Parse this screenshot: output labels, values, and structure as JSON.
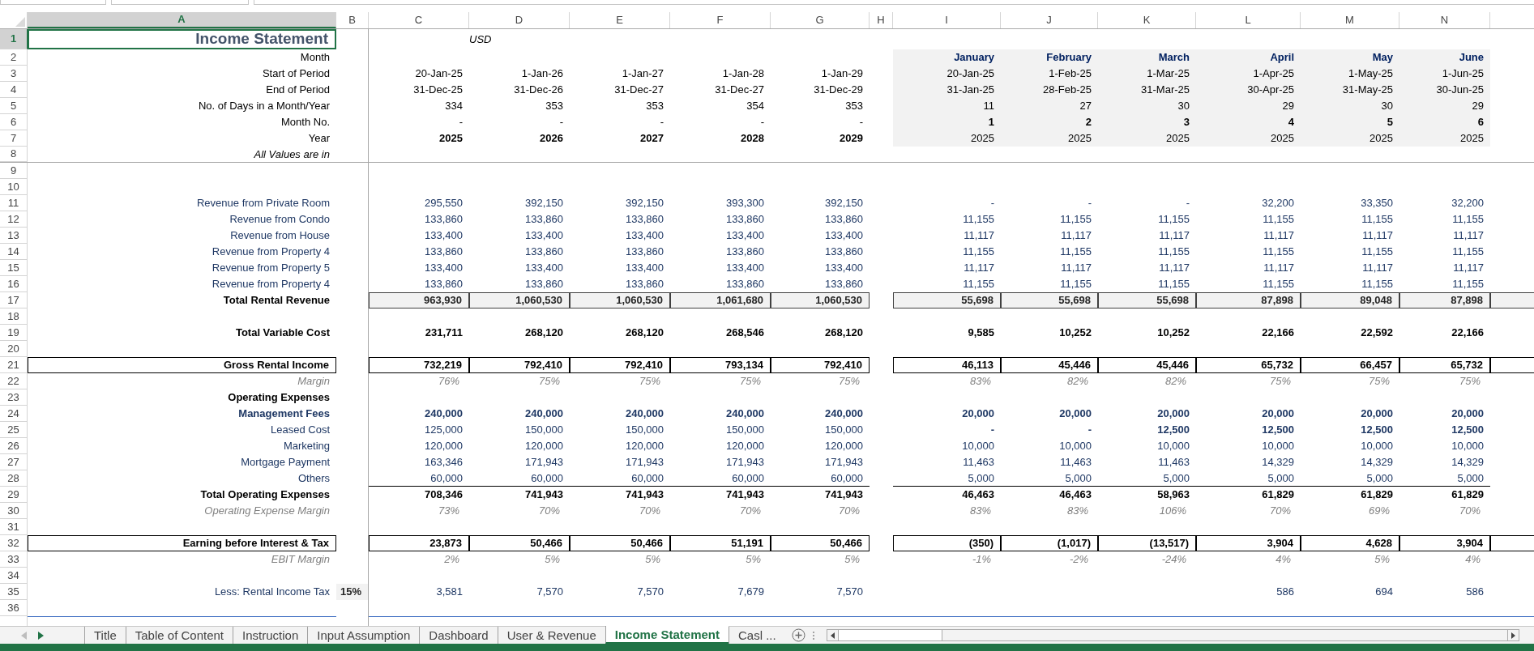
{
  "columns": [
    {
      "label": "A",
      "selected": true
    },
    {
      "label": "B",
      "selected": false
    },
    {
      "label": "C",
      "selected": false
    },
    {
      "label": "D",
      "selected": false
    },
    {
      "label": "E",
      "selected": false
    },
    {
      "label": "F",
      "selected": false
    },
    {
      "label": "G",
      "selected": false
    },
    {
      "label": "H",
      "selected": false
    },
    {
      "label": "I",
      "selected": false
    },
    {
      "label": "J",
      "selected": false
    },
    {
      "label": "K",
      "selected": false
    },
    {
      "label": "L",
      "selected": false
    },
    {
      "label": "M",
      "selected": false
    },
    {
      "label": "N",
      "selected": false
    }
  ],
  "rows": [
    {
      "number": "1",
      "selected": true,
      "kind": "title",
      "label": "Income Statement",
      "note": "USD"
    },
    {
      "number": "2",
      "selected": false,
      "kind": "header-month",
      "label": "Month",
      "monthly": [
        "January",
        "February",
        "March",
        "April",
        "May",
        "June"
      ]
    },
    {
      "number": "3",
      "selected": false,
      "kind": "plain",
      "label": "Start of Period",
      "annual": [
        "20-Jan-25",
        "1-Jan-26",
        "1-Jan-27",
        "1-Jan-28",
        "1-Jan-29"
      ],
      "monthly": [
        "20-Jan-25",
        "1-Feb-25",
        "1-Mar-25",
        "1-Apr-25",
        "1-May-25",
        "1-Jun-25"
      ]
    },
    {
      "number": "4",
      "selected": false,
      "kind": "plain",
      "label": "End of Period",
      "annual": [
        "31-Dec-25",
        "31-Dec-26",
        "31-Dec-27",
        "31-Dec-27",
        "31-Dec-29"
      ],
      "monthly": [
        "31-Jan-25",
        "28-Feb-25",
        "31-Mar-25",
        "30-Apr-25",
        "31-May-25",
        "30-Jun-25"
      ]
    },
    {
      "number": "5",
      "selected": false,
      "kind": "plain",
      "label": "No. of Days in a Month/Year",
      "annual": [
        "334",
        "353",
        "353",
        "354",
        "353"
      ],
      "monthly": [
        "11",
        "27",
        "30",
        "29",
        "30",
        "29"
      ]
    },
    {
      "number": "6",
      "selected": false,
      "kind": "monthno",
      "label": "Month No.",
      "annual": [
        "-",
        "-",
        "-",
        "-",
        "-"
      ],
      "monthly": [
        "1",
        "2",
        "3",
        "4",
        "5",
        "6"
      ]
    },
    {
      "number": "7",
      "selected": false,
      "kind": "year",
      "label": "Year",
      "annual": [
        "2025",
        "2026",
        "2027",
        "2028",
        "2029"
      ],
      "monthly": [
        "2025",
        "2025",
        "2025",
        "2025",
        "2025",
        "2025"
      ]
    },
    {
      "number": "8",
      "selected": false,
      "kind": "note",
      "label": "All Values are in"
    },
    {
      "number": "9",
      "selected": false,
      "kind": "empty"
    },
    {
      "number": "10",
      "selected": false,
      "kind": "empty"
    },
    {
      "number": "11",
      "selected": false,
      "kind": "revenue",
      "label": "Revenue from Private Room",
      "annual": [
        "295,550",
        "392,150",
        "392,150",
        "393,300",
        "392,150"
      ],
      "monthly": [
        "-",
        "-",
        "-",
        "32,200",
        "33,350",
        "32,200"
      ]
    },
    {
      "number": "12",
      "selected": false,
      "kind": "revenue",
      "label": "Revenue from Condo",
      "annual": [
        "133,860",
        "133,860",
        "133,860",
        "133,860",
        "133,860"
      ],
      "monthly": [
        "11,155",
        "11,155",
        "11,155",
        "11,155",
        "11,155",
        "11,155"
      ]
    },
    {
      "number": "13",
      "selected": false,
      "kind": "revenue",
      "label": "Revenue from House",
      "annual": [
        "133,400",
        "133,400",
        "133,400",
        "133,400",
        "133,400"
      ],
      "monthly": [
        "11,117",
        "11,117",
        "11,117",
        "11,117",
        "11,117",
        "11,117"
      ]
    },
    {
      "number": "14",
      "selected": false,
      "kind": "revenue",
      "label": "Revenue from Property 4",
      "annual": [
        "133,860",
        "133,860",
        "133,860",
        "133,860",
        "133,860"
      ],
      "monthly": [
        "11,155",
        "11,155",
        "11,155",
        "11,155",
        "11,155",
        "11,155"
      ]
    },
    {
      "number": "15",
      "selected": false,
      "kind": "revenue",
      "label": "Revenue from Property 5",
      "annual": [
        "133,400",
        "133,400",
        "133,400",
        "133,400",
        "133,400"
      ],
      "monthly": [
        "11,117",
        "11,117",
        "11,117",
        "11,117",
        "11,117",
        "11,117"
      ]
    },
    {
      "number": "16",
      "selected": false,
      "kind": "revenue",
      "label": "Revenue from Property 4",
      "annual": [
        "133,860",
        "133,860",
        "133,860",
        "133,860",
        "133,860"
      ],
      "monthly": [
        "11,155",
        "11,155",
        "11,155",
        "11,155",
        "11,155",
        "11,155"
      ]
    },
    {
      "number": "17",
      "selected": false,
      "kind": "total",
      "label": "Total Rental Revenue",
      "annual": [
        "963,930",
        "1,060,530",
        "1,060,530",
        "1,061,680",
        "1,060,530"
      ],
      "monthly": [
        "55,698",
        "55,698",
        "55,698",
        "87,898",
        "89,048",
        "87,898"
      ]
    },
    {
      "number": "18",
      "selected": false,
      "kind": "empty"
    },
    {
      "number": "19",
      "selected": false,
      "kind": "bold",
      "label": "Total Variable Cost",
      "annual": [
        "231,711",
        "268,120",
        "268,120",
        "268,546",
        "268,120"
      ],
      "monthly": [
        "9,585",
        "10,252",
        "10,252",
        "22,166",
        "22,592",
        "22,166"
      ]
    },
    {
      "number": "20",
      "selected": false,
      "kind": "empty"
    },
    {
      "number": "21",
      "selected": false,
      "kind": "boxed",
      "label": "Gross Rental Income",
      "annual": [
        "732,219",
        "792,410",
        "792,410",
        "793,134",
        "792,410"
      ],
      "monthly": [
        "46,113",
        "45,446",
        "45,446",
        "65,732",
        "66,457",
        "65,732"
      ]
    },
    {
      "number": "22",
      "selected": false,
      "kind": "margin",
      "label": "Margin",
      "annual": [
        "76%",
        "75%",
        "75%",
        "75%",
        "75%"
      ],
      "monthly": [
        "83%",
        "82%",
        "82%",
        "75%",
        "75%",
        "75%"
      ]
    },
    {
      "number": "23",
      "selected": false,
      "kind": "section",
      "label": "Operating Expenses"
    },
    {
      "number": "24",
      "selected": false,
      "kind": "navy-bold",
      "label": "Management Fees",
      "annual": [
        "240,000",
        "240,000",
        "240,000",
        "240,000",
        "240,000"
      ],
      "monthly": [
        "20,000",
        "20,000",
        "20,000",
        "20,000",
        "20,000",
        "20,000"
      ]
    },
    {
      "number": "25",
      "selected": false,
      "kind": "expense-mixed",
      "label": "Leased Cost",
      "annual": [
        "125,000",
        "150,000",
        "150,000",
        "150,000",
        "150,000"
      ],
      "monthly": [
        "-",
        "-",
        "12,500",
        "12,500",
        "12,500",
        "12,500"
      ]
    },
    {
      "number": "26",
      "selected": false,
      "kind": "expense",
      "label": "Marketing",
      "annual": [
        "120,000",
        "120,000",
        "120,000",
        "120,000",
        "120,000"
      ],
      "monthly": [
        "10,000",
        "10,000",
        "10,000",
        "10,000",
        "10,000",
        "10,000"
      ]
    },
    {
      "number": "27",
      "selected": false,
      "kind": "expense",
      "label": "Mortgage Payment",
      "annual": [
        "163,346",
        "171,943",
        "171,943",
        "171,943",
        "171,943"
      ],
      "monthly": [
        "11,463",
        "11,463",
        "11,463",
        "14,329",
        "14,329",
        "14,329"
      ]
    },
    {
      "number": "28",
      "selected": false,
      "kind": "expense-last",
      "label": "Others",
      "annual": [
        "60,000",
        "60,000",
        "60,000",
        "60,000",
        "60,000"
      ],
      "monthly": [
        "5,000",
        "5,000",
        "5,000",
        "5,000",
        "5,000",
        "5,000"
      ]
    },
    {
      "number": "29",
      "selected": false,
      "kind": "bold",
      "label": "Total Operating Expenses",
      "annual": [
        "708,346",
        "741,943",
        "741,943",
        "741,943",
        "741,943"
      ],
      "monthly": [
        "46,463",
        "46,463",
        "58,963",
        "61,829",
        "61,829",
        "61,829"
      ]
    },
    {
      "number": "30",
      "selected": false,
      "kind": "margin",
      "label": "Operating Expense Margin",
      "annual": [
        "73%",
        "70%",
        "70%",
        "70%",
        "70%"
      ],
      "monthly": [
        "83%",
        "83%",
        "106%",
        "70%",
        "69%",
        "70%"
      ]
    },
    {
      "number": "31",
      "selected": false,
      "kind": "empty"
    },
    {
      "number": "32",
      "selected": false,
      "kind": "boxed",
      "label": "Earning before Interest & Tax",
      "annual": [
        "23,873",
        "50,466",
        "50,466",
        "51,191",
        "50,466"
      ],
      "monthly": [
        "(350)",
        "(1,017)",
        "(13,517)",
        "3,904",
        "4,628",
        "3,904"
      ]
    },
    {
      "number": "33",
      "selected": false,
      "kind": "margin",
      "label": "EBIT Margin",
      "annual": [
        "2%",
        "5%",
        "5%",
        "5%",
        "5%"
      ],
      "monthly": [
        "-1%",
        "-2%",
        "-24%",
        "4%",
        "5%",
        "4%"
      ]
    },
    {
      "number": "34",
      "selected": false,
      "kind": "empty"
    },
    {
      "number": "35",
      "selected": false,
      "kind": "tax",
      "label": "Less: Rental Income Tax",
      "rate": "15%",
      "annual": [
        "3,581",
        "7,570",
        "7,570",
        "7,679",
        "7,570"
      ],
      "monthly": [
        "586",
        "694",
        "586"
      ]
    },
    {
      "number": "36",
      "selected": false,
      "kind": "empty"
    }
  ],
  "sheet_tabs": [
    {
      "label": "Title",
      "selected": false
    },
    {
      "label": "Table of Content",
      "selected": false
    },
    {
      "label": "Instruction",
      "selected": false
    },
    {
      "label": "Input Assumption",
      "selected": false
    },
    {
      "label": "Dashboard",
      "selected": false
    },
    {
      "label": "User & Revenue",
      "selected": false
    },
    {
      "label": "Income Statement",
      "selected": true
    },
    {
      "label": "Casl ...",
      "selected": false
    }
  ]
}
